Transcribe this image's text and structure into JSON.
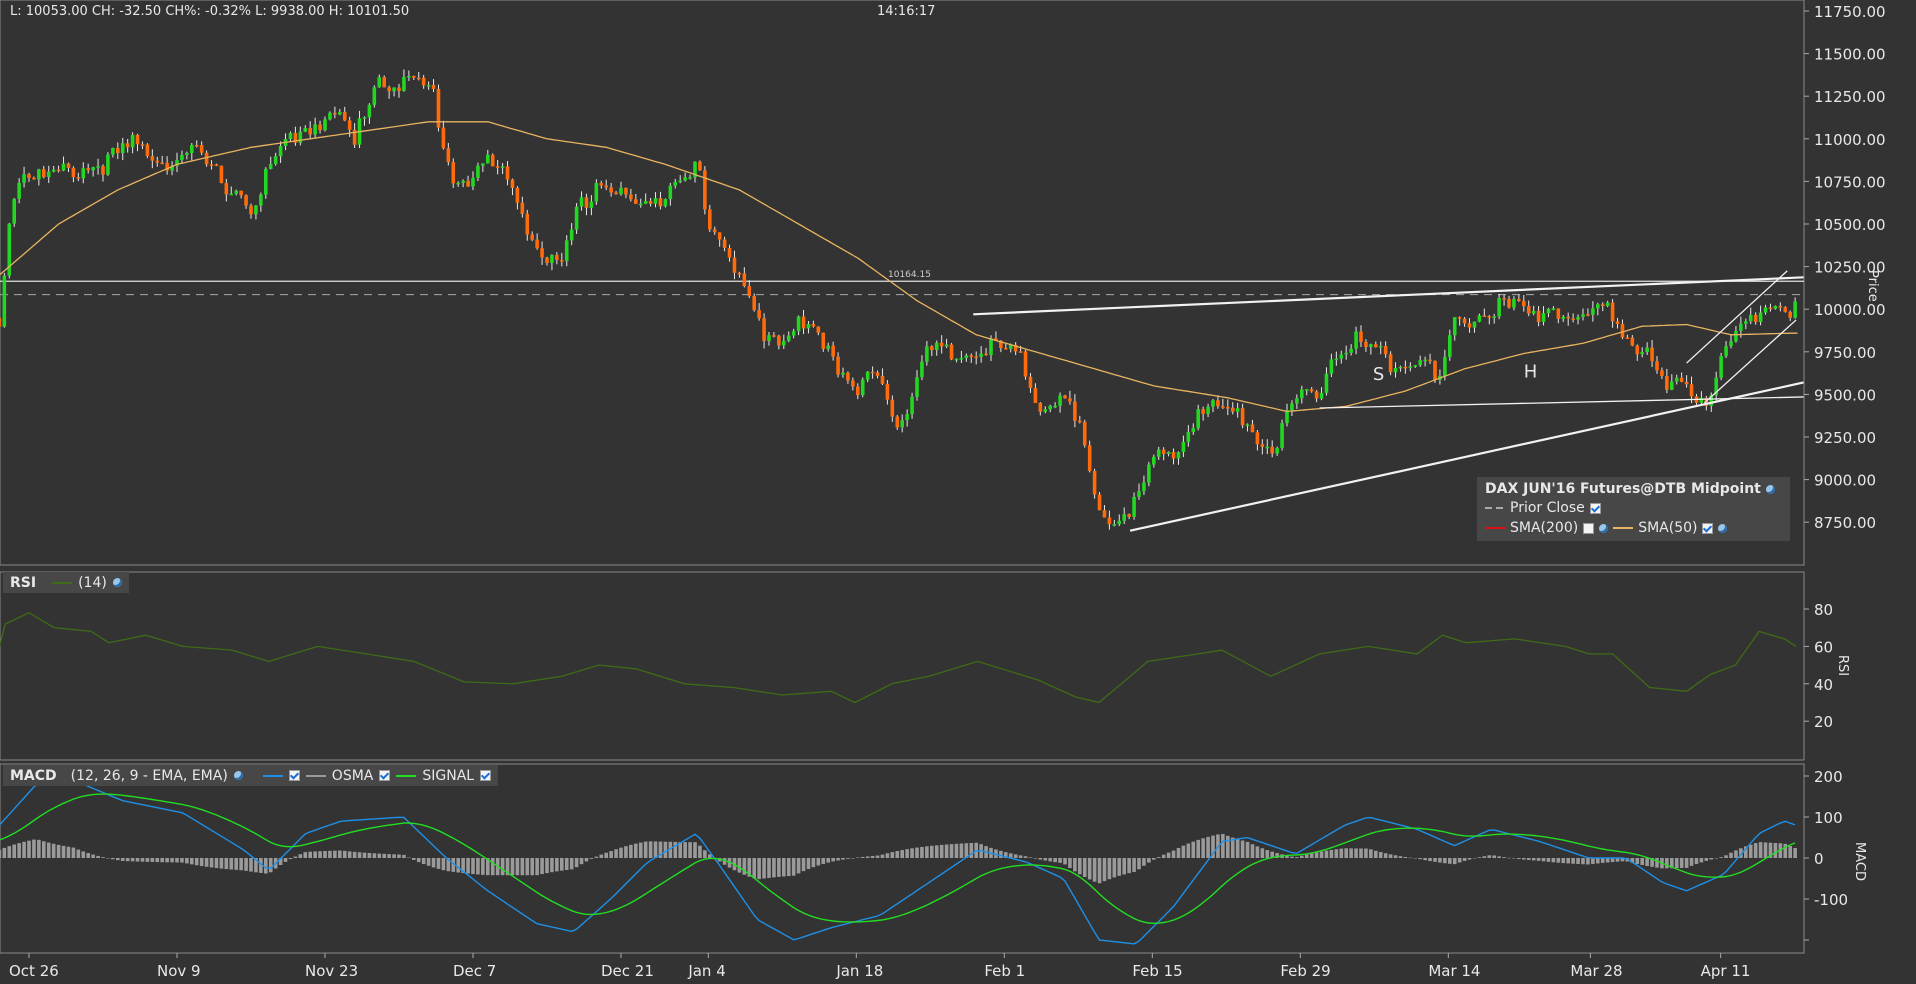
{
  "header": {
    "quote_text": "L: 10053.00 CH: -32.50  CH%: -0.32% L: 9938.00 H: 10101.50",
    "time": "14:16:17"
  },
  "legend": {
    "title": "DAX JUN'16 Futures@DTB Midpoint",
    "prior_close": "Prior Close",
    "sma200": "SMA(200)",
    "sma50": "SMA(50)",
    "sma200_checked": false,
    "sma50_checked": true,
    "prior_close_checked": true
  },
  "rsi_header": {
    "name": "RSI",
    "params": "(14)"
  },
  "macd_header": {
    "name": "MACD",
    "params": "(12, 26, 9 - EMA, EMA)",
    "osma": "OSMA",
    "signal": "SIGNAL"
  },
  "axis_titles": {
    "price": "Price",
    "rsi": "RSI",
    "macd": "MACD"
  },
  "colors": {
    "background": "#333333",
    "up": "#22d622",
    "down": "#ff6a0a",
    "sma50": "#e8b460",
    "sma200": "#e01010",
    "rsi": "#3f6b16",
    "macd": "#1e90e8",
    "signal": "#22dd22",
    "osma": "#9a9a9a"
  },
  "chart_data": [
    {
      "type": "candlestick",
      "title": "DAX JUN'16 Futures@DTB Midpoint",
      "ylabel": "Price",
      "ylim": [
        8600,
        11800
      ],
      "yticks": [
        "11750.00",
        "11500.00",
        "11250.00",
        "11000.00",
        "10750.00",
        "10500.00",
        "10250.00",
        "10000.00",
        "9750.00",
        "9500.00",
        "9250.00",
        "9000.00",
        "8750.00"
      ],
      "bars_per_day": 3,
      "close_keypoints_tday_price": [
        [
          -2,
          9950
        ],
        [
          -1.2,
          10700
        ],
        [
          -0.3,
          10850
        ],
        [
          1.3,
          10800
        ],
        [
          3,
          10850
        ],
        [
          5.4,
          10900
        ],
        [
          7.1,
          11000
        ],
        [
          9.6,
          10900
        ],
        [
          11.2,
          10950
        ],
        [
          12.9,
          10800
        ],
        [
          14.5,
          10700
        ],
        [
          15.3,
          10600
        ],
        [
          16.2,
          10850
        ],
        [
          17.8,
          11050
        ],
        [
          19.5,
          11150
        ],
        [
          21.1,
          11150
        ],
        [
          22,
          11000
        ],
        [
          22.8,
          11250
        ],
        [
          23.6,
          11400
        ],
        [
          25.3,
          11350
        ],
        [
          26.5,
          11350
        ],
        [
          27.3,
          11300
        ],
        [
          28.6,
          10800
        ],
        [
          29.8,
          10800
        ],
        [
          31,
          10900
        ],
        [
          32.7,
          10750
        ],
        [
          34.3,
          10400
        ],
        [
          36,
          10250
        ],
        [
          36.8,
          10550
        ],
        [
          38.5,
          10800
        ],
        [
          40.1,
          10700
        ],
        [
          41.8,
          10600
        ],
        [
          43.4,
          10800
        ],
        [
          45.1,
          10900
        ],
        [
          45.9,
          10500
        ],
        [
          47.6,
          10300
        ],
        [
          48.8,
          10150
        ],
        [
          49.6,
          9900
        ],
        [
          50.9,
          9800
        ],
        [
          52.5,
          10000
        ],
        [
          54.2,
          9800
        ],
        [
          55.8,
          9500
        ],
        [
          57.5,
          9700
        ],
        [
          58.7,
          9350
        ],
        [
          60,
          9600
        ],
        [
          60.8,
          9800
        ],
        [
          62.4,
          9750
        ],
        [
          64.1,
          9800
        ],
        [
          65.7,
          9800
        ],
        [
          67.4,
          9700
        ],
        [
          68.2,
          9500
        ],
        [
          69.9,
          9500
        ],
        [
          71.1,
          9300
        ],
        [
          71.9,
          8900
        ],
        [
          73.2,
          8800
        ],
        [
          74.8,
          8900
        ],
        [
          76.1,
          9150
        ],
        [
          77.7,
          9200
        ],
        [
          78.9,
          9450
        ],
        [
          80.6,
          9450
        ],
        [
          82.3,
          9400
        ],
        [
          83.9,
          9200
        ],
        [
          85.6,
          9500
        ],
        [
          87.2,
          9550
        ],
        [
          88,
          9800
        ],
        [
          89.7,
          9850
        ],
        [
          91.3,
          9750
        ],
        [
          93,
          9700
        ],
        [
          94.2,
          9800
        ],
        [
          95.1,
          9550
        ],
        [
          96.3,
          9950
        ],
        [
          97.9,
          10000
        ],
        [
          99.6,
          10050
        ],
        [
          101.3,
          10000
        ],
        [
          102.9,
          10050
        ],
        [
          104.6,
          9950
        ],
        [
          106.2,
          10050
        ],
        [
          107.9,
          9900
        ],
        [
          109.5,
          9750
        ],
        [
          110.7,
          9550
        ],
        [
          112,
          9600
        ],
        [
          113.2,
          9500
        ],
        [
          114.5,
          9750
        ],
        [
          116.1,
          9950
        ],
        [
          117.4,
          10100
        ],
        [
          118.6,
          10050
        ],
        [
          119.4,
          10053
        ]
      ],
      "sma50_keypoints": [
        [
          -2,
          10200
        ],
        [
          2,
          10500
        ],
        [
          6,
          10700
        ],
        [
          10,
          10850
        ],
        [
          15,
          10950
        ],
        [
          19,
          11000
        ],
        [
          23,
          11050
        ],
        [
          27,
          11100
        ],
        [
          31,
          11100
        ],
        [
          35,
          11000
        ],
        [
          39,
          10950
        ],
        [
          43,
          10850
        ],
        [
          48,
          10700
        ],
        [
          52,
          10500
        ],
        [
          56,
          10300
        ],
        [
          60,
          10050
        ],
        [
          64,
          9850
        ],
        [
          68,
          9750
        ],
        [
          72,
          9650
        ],
        [
          76,
          9550
        ],
        [
          81,
          9480
        ],
        [
          85,
          9400
        ],
        [
          89,
          9430
        ],
        [
          93,
          9520
        ],
        [
          97,
          9650
        ],
        [
          101,
          9740
        ],
        [
          105,
          9800
        ],
        [
          109,
          9900
        ],
        [
          112,
          9910
        ],
        [
          115,
          9850
        ],
        [
          119.5,
          9860
        ]
      ],
      "reference_lines": {
        "level": 10164.15,
        "level_label": "10164.15",
        "prior_close": 10085.5
      },
      "trendlines": [
        [
          [
            74.4,
            8700
          ],
          [
            119.9,
            9570
          ]
        ],
        [
          [
            63.8,
            9970
          ],
          [
            119.9,
            10187
          ]
        ],
        [
          [
            87.2,
            9420
          ],
          [
            119.9,
            9485
          ]
        ],
        [
          [
            112,
            9684
          ],
          [
            118.8,
            10225
          ]
        ],
        [
          [
            113.2,
            9450
          ],
          [
            119.4,
            9937
          ]
        ]
      ],
      "annotations": [
        {
          "text": "S",
          "t": 90.8,
          "price": 9585
        },
        {
          "text": "H",
          "t": 101,
          "price": 9600
        }
      ],
      "xticks": [
        {
          "label": "Oct 26",
          "t": 0
        },
        {
          "label": "Nov 9",
          "t": 10
        },
        {
          "label": "Nov 23",
          "t": 20
        },
        {
          "label": "Dec 7",
          "t": 30
        },
        {
          "label": "Dec 21",
          "t": 40
        },
        {
          "label": "Jan 4",
          "t": 45.9
        },
        {
          "label": "Jan 18",
          "t": 55.9
        },
        {
          "label": "Feb 1",
          "t": 65.9
        },
        {
          "label": "Feb 15",
          "t": 75.9
        },
        {
          "label": "Feb 29",
          "t": 85.9
        },
        {
          "label": "Mar 14",
          "t": 95.9
        },
        {
          "label": "Mar 28",
          "t": 105.5
        },
        {
          "label": "Apr 11",
          "t": 114.3
        }
      ]
    },
    {
      "type": "line",
      "title": "RSI (14)",
      "ylim": [
        0,
        100
      ],
      "yticks": [
        "80",
        "60",
        "40",
        "20"
      ],
      "keypoints": [
        [
          -2,
          60
        ],
        [
          -1.6,
          72
        ],
        [
          0,
          78
        ],
        [
          1.7,
          70
        ],
        [
          4.2,
          68
        ],
        [
          5.4,
          62
        ],
        [
          7.9,
          66
        ],
        [
          10.4,
          60
        ],
        [
          13.7,
          58
        ],
        [
          16.2,
          52
        ],
        [
          19.5,
          60
        ],
        [
          22.8,
          56
        ],
        [
          26,
          52
        ],
        [
          29.4,
          41
        ],
        [
          32.7,
          40
        ],
        [
          36,
          44
        ],
        [
          38.5,
          50
        ],
        [
          41,
          48
        ],
        [
          44.3,
          40
        ],
        [
          47.6,
          38
        ],
        [
          50.9,
          34
        ],
        [
          54.2,
          36
        ],
        [
          55.8,
          30
        ],
        [
          58.3,
          40
        ],
        [
          60.8,
          44
        ],
        [
          64.1,
          52
        ],
        [
          68.2,
          42
        ],
        [
          70.7,
          33
        ],
        [
          72.3,
          30
        ],
        [
          75.6,
          52
        ],
        [
          79,
          56
        ],
        [
          80.6,
          58
        ],
        [
          83.9,
          44
        ],
        [
          87.2,
          56
        ],
        [
          90.5,
          60
        ],
        [
          93.8,
          56
        ],
        [
          95.5,
          66
        ],
        [
          97.1,
          62
        ],
        [
          100.4,
          64
        ],
        [
          103.8,
          60
        ],
        [
          105.4,
          56
        ],
        [
          107,
          56
        ],
        [
          109.5,
          38
        ],
        [
          112,
          36
        ],
        [
          113.6,
          45
        ],
        [
          115.3,
          50
        ],
        [
          116.9,
          68
        ],
        [
          118.6,
          64
        ],
        [
          119.4,
          60
        ]
      ]
    },
    {
      "type": "line+bar",
      "title": "MACD (12, 26, 9 - EMA, EMA)",
      "yticks": [
        "200",
        "100",
        "0",
        "-100"
      ],
      "macd_keypoints": [
        [
          -2,
          80
        ],
        [
          0.5,
          180
        ],
        [
          3,
          190
        ],
        [
          6.3,
          140
        ],
        [
          10.4,
          110
        ],
        [
          14.5,
          20
        ],
        [
          16.2,
          -30
        ],
        [
          18.7,
          60
        ],
        [
          21.1,
          90
        ],
        [
          25.3,
          100
        ],
        [
          28.2,
          0
        ],
        [
          31,
          -80
        ],
        [
          34.3,
          -160
        ],
        [
          36.8,
          -180
        ],
        [
          39.3,
          -100
        ],
        [
          41.8,
          -10
        ],
        [
          45.1,
          60
        ],
        [
          46.7,
          -20
        ],
        [
          49.2,
          -150
        ],
        [
          51.7,
          -200
        ],
        [
          54.2,
          -170
        ],
        [
          57.5,
          -140
        ],
        [
          60.8,
          -60
        ],
        [
          64.1,
          20
        ],
        [
          67.4,
          -10
        ],
        [
          69.9,
          -50
        ],
        [
          72.3,
          -200
        ],
        [
          74.8,
          -210
        ],
        [
          77.3,
          -120
        ],
        [
          80.6,
          40
        ],
        [
          82.3,
          50
        ],
        [
          85.6,
          10
        ],
        [
          88.9,
          80
        ],
        [
          90.5,
          100
        ],
        [
          93.8,
          70
        ],
        [
          96.3,
          30
        ],
        [
          98.8,
          70
        ],
        [
          102.1,
          40
        ],
        [
          105.4,
          0
        ],
        [
          107.9,
          0
        ],
        [
          110.4,
          -60
        ],
        [
          112,
          -80
        ],
        [
          114.5,
          -40
        ],
        [
          116.9,
          60
        ],
        [
          118.6,
          90
        ],
        [
          119.4,
          80
        ]
      ],
      "signal_period_bars": 20
    }
  ]
}
